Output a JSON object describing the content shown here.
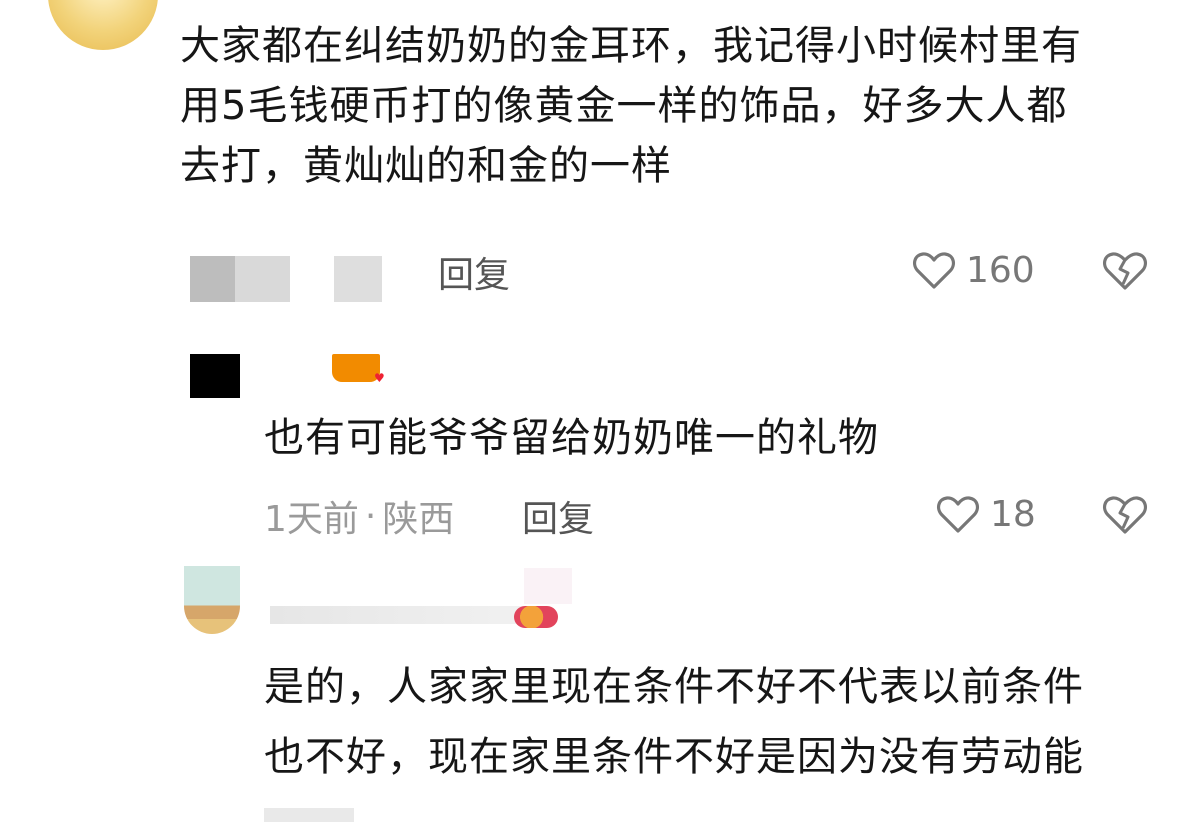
{
  "comments": [
    {
      "text_lines": [
        "大家都在纠结奶奶的金耳环，我记得小时候村里有",
        "用5毛钱硬币打的像黄金一样的饰品，好多大人都",
        "去打，黄灿灿的和金的一样"
      ],
      "reply_label": "回复",
      "likes": "160"
    },
    {
      "text": "也有可能爷爷留给奶奶唯一的礼物",
      "time": "1天前",
      "location": "陕西",
      "separator": "·",
      "reply_label": "回复",
      "likes": "18"
    },
    {
      "text_lines": [
        "是的，人家家里现在条件不好不代表以前条件",
        "也不好，现在家里条件不好是因为没有劳动能"
      ]
    }
  ],
  "icons": {
    "like": "heart-outline-icon",
    "dislike": "broken-heart-icon"
  },
  "colors": {
    "highlight_badge": "#f28b00"
  }
}
